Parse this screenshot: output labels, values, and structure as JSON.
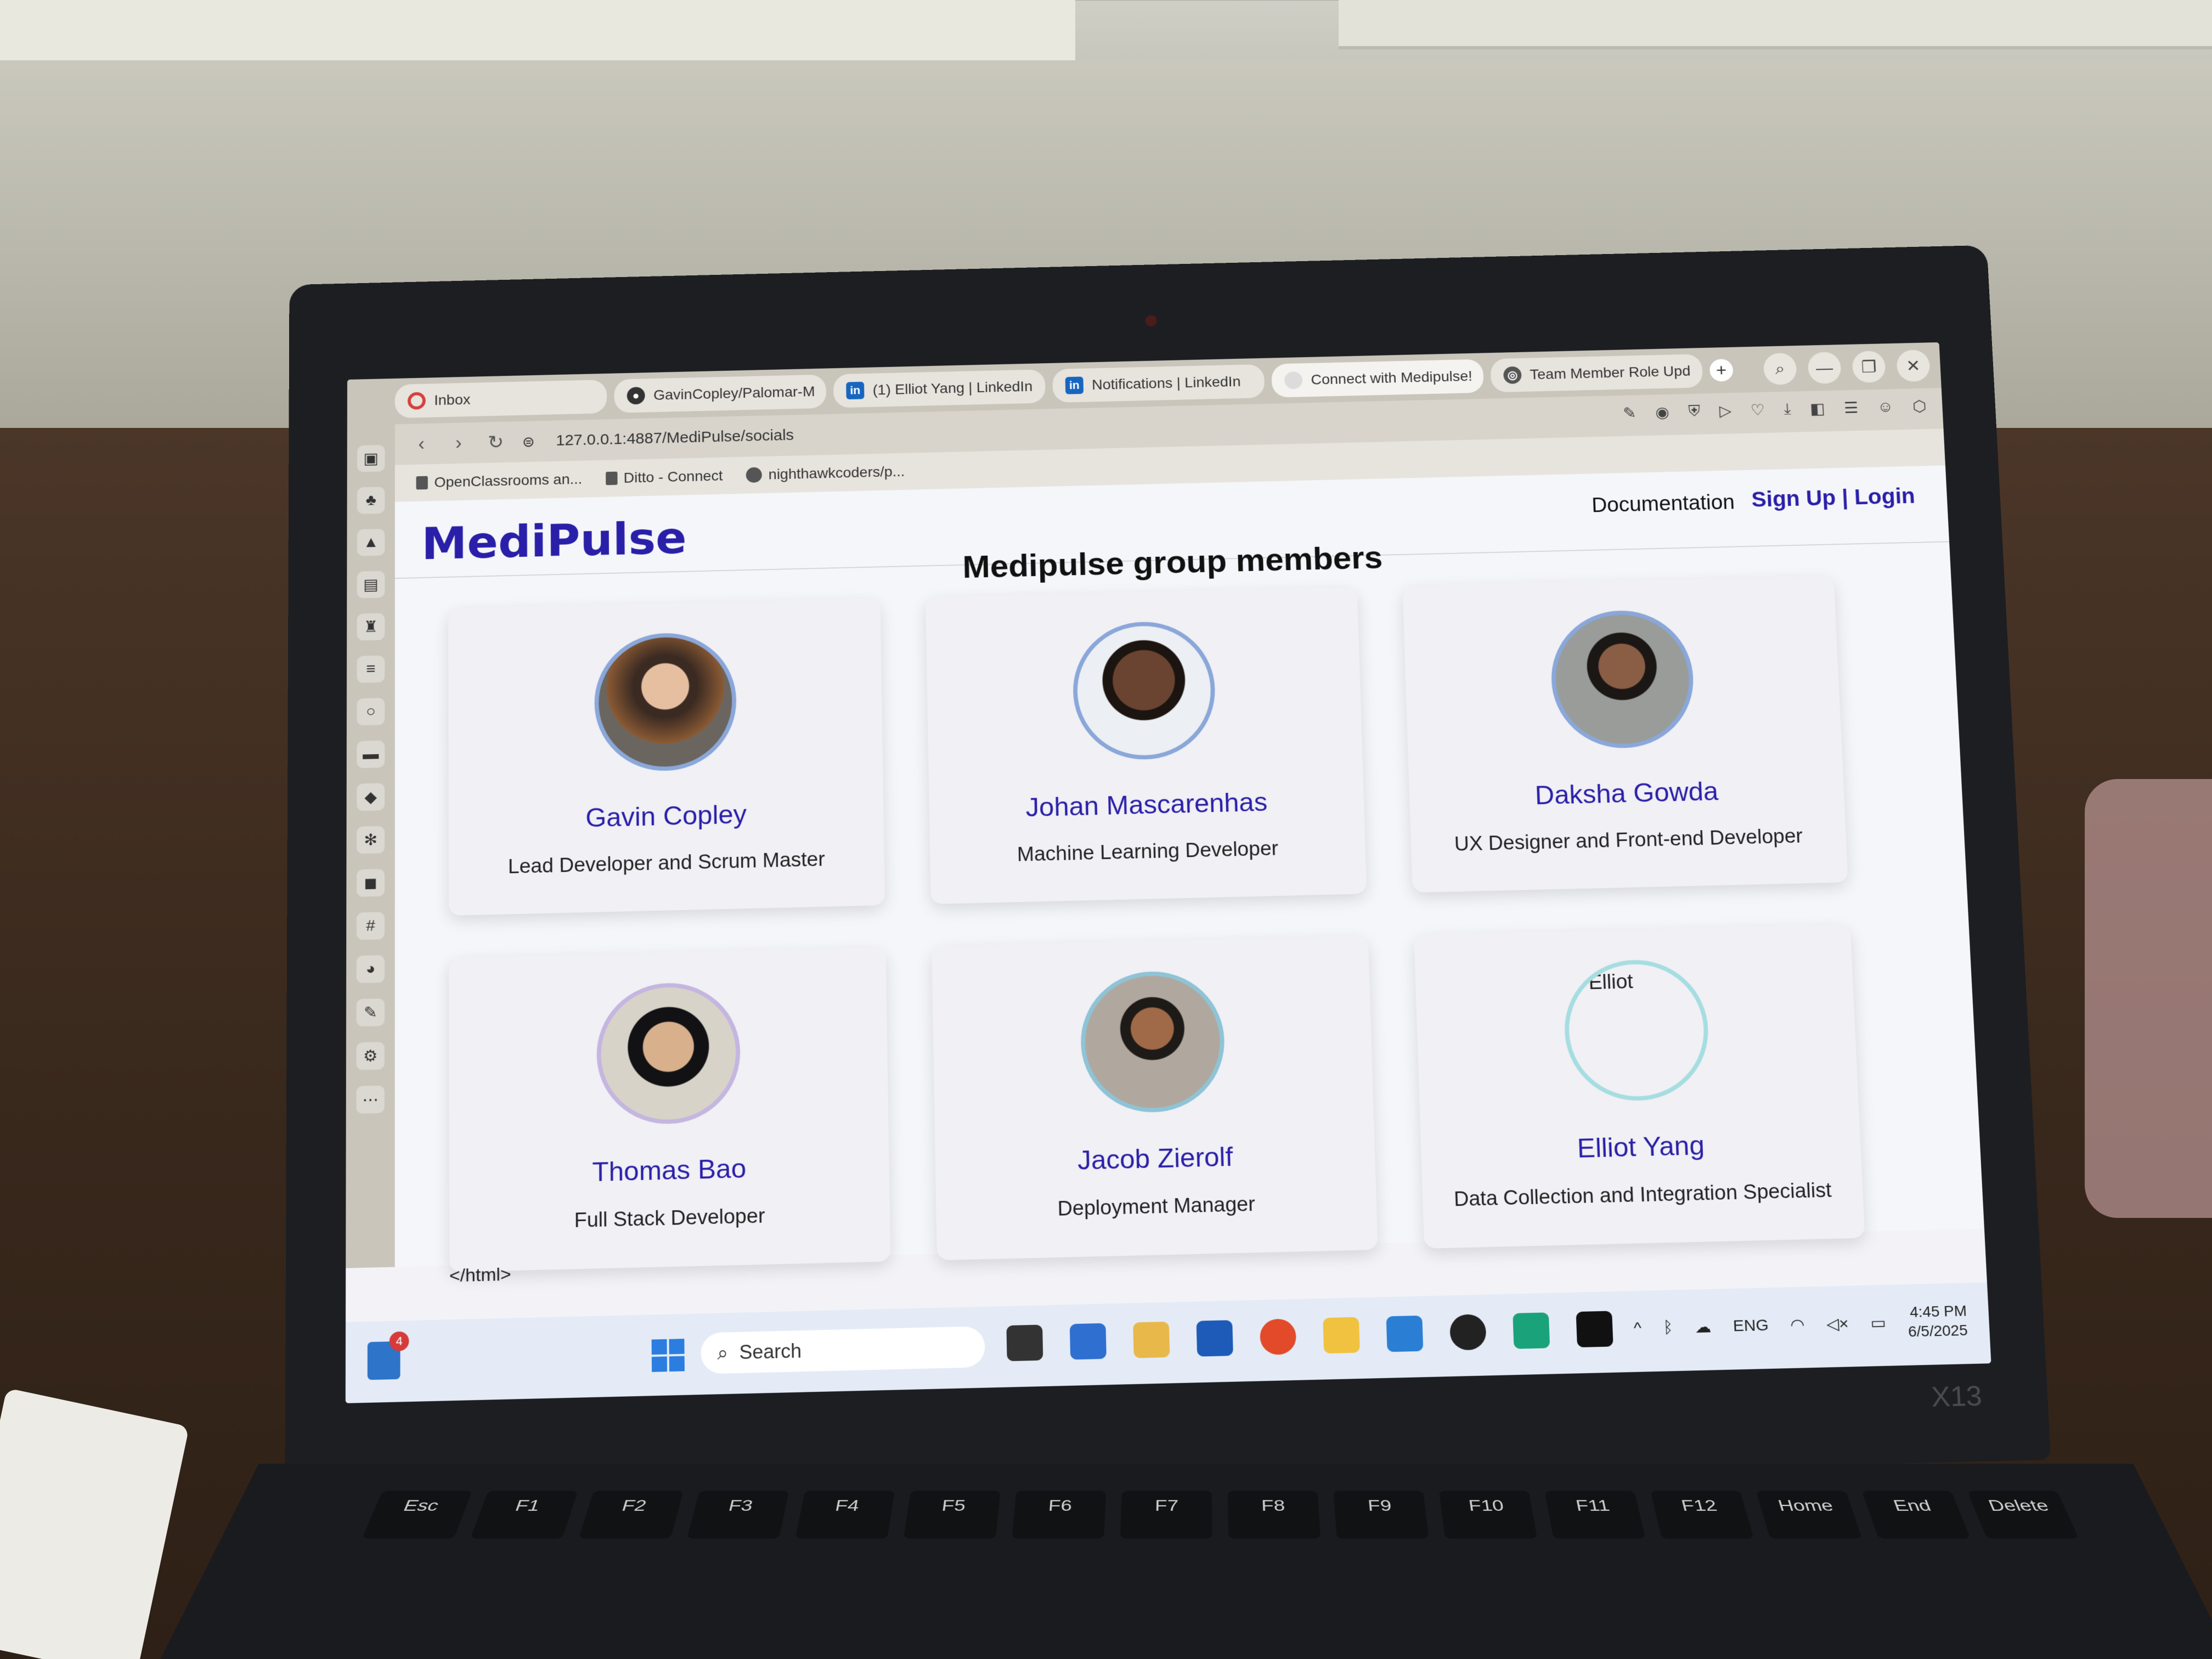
{
  "browser": {
    "tabs": [
      {
        "label": "Inbox",
        "icon": "gmail-icon"
      },
      {
        "label": "GavinCopley/Palomar-M",
        "icon": "github-icon"
      },
      {
        "label": "(1) Elliot Yang | LinkedIn",
        "icon": "linkedin-icon"
      },
      {
        "label": "Notifications | LinkedIn",
        "icon": "linkedin-icon"
      },
      {
        "label": "Connect with Medipulse!",
        "icon": "medipulse-icon"
      },
      {
        "label": "Team Member Role Upd",
        "icon": "chatgpt-icon"
      }
    ],
    "url": "127.0.0.1:4887/MediPulse/socials",
    "bookmarks": [
      {
        "label": "OpenClassrooms an..."
      },
      {
        "label": "Ditto - Connect"
      },
      {
        "label": "nighthawkcoders/p..."
      }
    ]
  },
  "page": {
    "brand": "MediPulse",
    "nav_documentation": "Documentation",
    "nav_auth": "Sign Up | Login",
    "section_title": "Medipulse group members",
    "members": [
      {
        "name": "Gavin Copley",
        "role": "Lead Developer and Scrum Master"
      },
      {
        "name": "Johan Mascarenhas",
        "role": "Machine Learning Developer"
      },
      {
        "name": "Daksha Gowda",
        "role": "UX Designer and Front-end Developer"
      },
      {
        "name": "Thomas Bao",
        "role": "Full Stack Developer"
      },
      {
        "name": "Jacob Zierolf",
        "role": "Deployment Manager"
      },
      {
        "name": "Elliot Yang",
        "role": "Data Collection and Integration Specialist",
        "image_alt": "Elliot"
      }
    ],
    "footer_text": "</html>"
  },
  "taskbar": {
    "notification_count": "4",
    "search_placeholder": "Search",
    "language": "ENG",
    "time": "4:45 PM",
    "date": "6/5/2025"
  },
  "laptop": {
    "model": "X13"
  },
  "keyboard": {
    "keys": [
      "Esc",
      "F1",
      "F2",
      "F3",
      "F4",
      "F5",
      "F6",
      "F7",
      "F8",
      "F9",
      "F10",
      "F11",
      "F12",
      "Home",
      "End",
      "Delete"
    ]
  }
}
